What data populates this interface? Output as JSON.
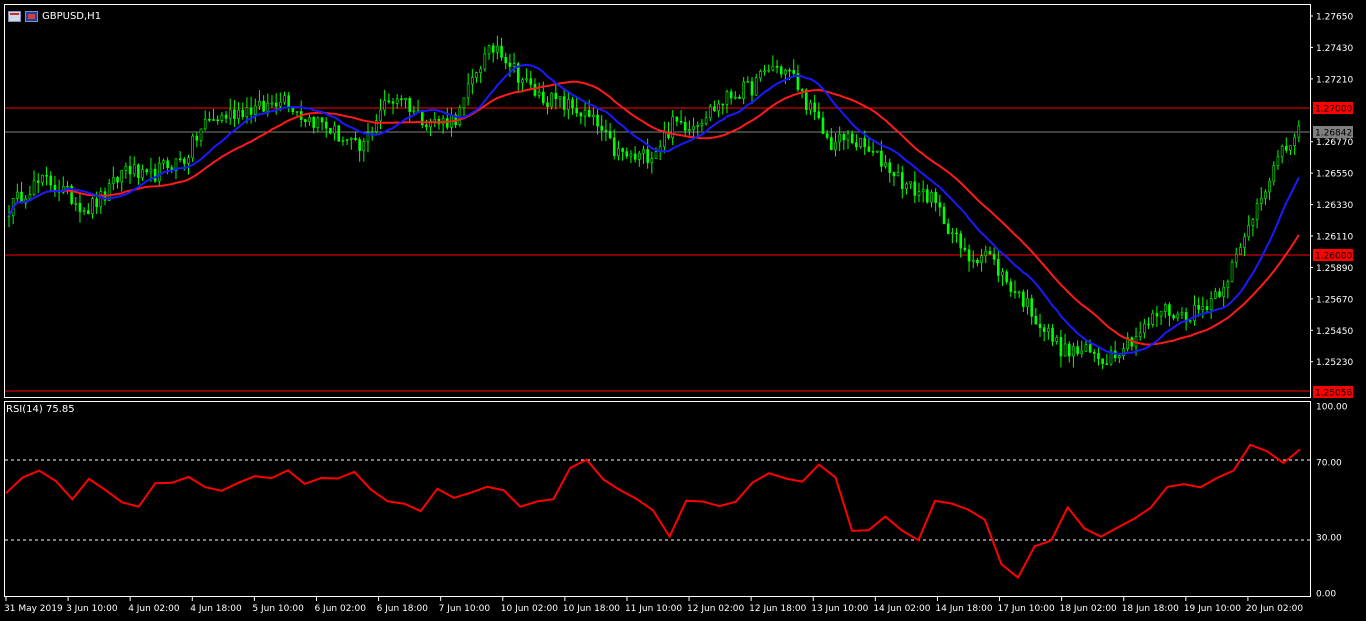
{
  "window": {
    "symbol_title": "GBPUSD,H1",
    "icons": [
      "chart-window-icon",
      "flag-icon"
    ]
  },
  "colors": {
    "background": "#000000",
    "grid": "#ffffff",
    "bull_candle": "#00ff00",
    "bear_candle": "#00ff00",
    "ma_fast": "#1a1aff",
    "ma_slow": "#ff1a1a",
    "level_line": "#ff0000",
    "current_price_line": "#7f7f7f",
    "rsi_line": "#ff0000",
    "axis_text": "#ffffff"
  },
  "price_axis_labels": [
    "1.27650",
    "1.27430",
    "1.27210",
    "1.26770",
    "1.26550",
    "1.26330",
    "1.26110",
    "1.25890",
    "1.25670",
    "1.25450",
    "1.25230"
  ],
  "price_tags": {
    "level_high": "1.27000",
    "current": "1.26842",
    "level_mid": "1.26000",
    "level_low": "1.25056"
  },
  "rsi": {
    "label": "RSI(14) 75.85",
    "axis_labels": [
      "100.00",
      "70.00",
      "30.00",
      "0.00"
    ],
    "levels": [
      70,
      30
    ]
  },
  "time_axis_labels": [
    "31 May 2019",
    "3 Jun 10:00",
    "4 Jun 02:00",
    "4 Jun 18:00",
    "5 Jun 10:00",
    "6 Jun 02:00",
    "6 Jun 18:00",
    "7 Jun 10:00",
    "10 Jun 02:00",
    "10 Jun 18:00",
    "11 Jun 10:00",
    "12 Jun 02:00",
    "12 Jun 18:00",
    "13 Jun 10:00",
    "14 Jun 02:00",
    "14 Jun 18:00",
    "17 Jun 10:00",
    "18 Jun 02:00",
    "18 Jun 18:00",
    "19 Jun 10:00",
    "20 Jun 02:00"
  ],
  "chart_data": [
    {
      "type": "candlestick",
      "title": "GBPUSD,H1",
      "ylim": [
        1.2499,
        1.2772
      ],
      "x_ticks": [
        "31 May 2019",
        "3 Jun 10:00",
        "4 Jun 02:00",
        "4 Jun 18:00",
        "5 Jun 10:00",
        "6 Jun 02:00",
        "6 Jun 18:00",
        "7 Jun 10:00",
        "10 Jun 02:00",
        "10 Jun 18:00",
        "11 Jun 10:00",
        "12 Jun 02:00",
        "12 Jun 18:00",
        "13 Jun 10:00",
        "14 Jun 02:00",
        "14 Jun 18:00",
        "17 Jun 10:00",
        "18 Jun 02:00",
        "18 Jun 18:00",
        "19 Jun 10:00",
        "20 Jun 02:00"
      ],
      "horizontal_levels": [
        1.27,
        1.26,
        1.25056
      ],
      "current_price": 1.26842,
      "close_path": [
        1.263,
        1.2645,
        1.265,
        1.264,
        1.263,
        1.264,
        1.266,
        1.265,
        1.266,
        1.2665,
        1.269,
        1.2695,
        1.27,
        1.27,
        1.271,
        1.2695,
        1.269,
        1.268,
        1.267,
        1.27,
        1.271,
        1.2695,
        1.269,
        1.2695,
        1.273,
        1.2745,
        1.2725,
        1.271,
        1.2705,
        1.27,
        1.269,
        1.267,
        1.2665,
        1.267,
        1.269,
        1.269,
        1.27,
        1.271,
        1.2715,
        1.273,
        1.2725,
        1.27,
        1.2675,
        1.268,
        1.267,
        1.266,
        1.2645,
        1.264,
        1.262,
        1.2595,
        1.26,
        1.258,
        1.2565,
        1.2545,
        1.253,
        1.253,
        1.2525,
        1.2535,
        1.2545,
        1.256,
        1.2555,
        1.256,
        1.2575,
        1.26,
        1.264,
        1.2665,
        1.2685
      ],
      "series": [
        {
          "name": "",
          "values": "moving average (fast)"
        },
        {
          "name": "",
          "values": "moving average (slow)"
        }
      ]
    },
    {
      "type": "line",
      "title": "RSI(14) 75.85",
      "ylim": [
        0,
        100
      ],
      "y_ticks": [
        100,
        70,
        30,
        0
      ],
      "reference_lines": [
        70,
        30
      ],
      "last_value": 75.85,
      "values": [
        55,
        60,
        65,
        58,
        52,
        60,
        55,
        50,
        45,
        58,
        60,
        62,
        58,
        55,
        60,
        62,
        60,
        65,
        58,
        62,
        60,
        65,
        55,
        50,
        48,
        45,
        55,
        50,
        52,
        58,
        55,
        48,
        50,
        52,
        65,
        72,
        62,
        55,
        50,
        45,
        30,
        50,
        48,
        45,
        50,
        58,
        65,
        62,
        60,
        70,
        60,
        35,
        32,
        40,
        35,
        30,
        50,
        48,
        45,
        40,
        15,
        10,
        25,
        30,
        45,
        35,
        30,
        35,
        40,
        45,
        55,
        58,
        55,
        60,
        65,
        78,
        75,
        70,
        76
      ]
    }
  ]
}
